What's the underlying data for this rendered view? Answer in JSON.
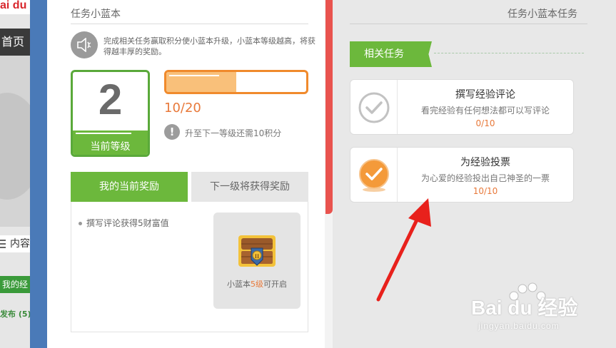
{
  "background_page": {
    "logo": "ai du",
    "nav_item": "首页",
    "content_label": "内容",
    "green_item": "我的经",
    "publish_text": "发布 (5)"
  },
  "left_panel": {
    "title": "任务小蓝本",
    "intro": "完成相关任务赢取积分使小蓝本升级，小蓝本等级越高，将获得越丰厚的奖励。",
    "level": {
      "value": "2",
      "label": "当前等级"
    },
    "progress": {
      "text": "10/20",
      "fraction": 0.5,
      "hint": "升至下一等级还需10积分"
    },
    "tabs": {
      "current": "我的当前奖励",
      "next": "下一级将获得奖励"
    },
    "reward_item": "撰写评论获得5财富值",
    "chest": {
      "prefix": "小蓝本",
      "level": "5级",
      "suffix": "可开启"
    }
  },
  "right_panel": {
    "title": "任务小蓝本任务",
    "related_label": "相关任务",
    "tasks": [
      {
        "title": "撰写经验评论",
        "desc": "看完经验有任何想法都可以写评论",
        "progress": "0/10",
        "completed": false
      },
      {
        "title": "为经验投票",
        "desc": "为心爱的经验投出自己神圣的一票",
        "progress": "10/10",
        "completed": true
      }
    ]
  },
  "watermark": {
    "text": "Bai du 经验",
    "sub": "jingyan.baidu.com"
  },
  "colors": {
    "green": "#6cb83c",
    "orange": "#e8793a",
    "red": "#e9534e",
    "arrow": "#e8211c"
  }
}
